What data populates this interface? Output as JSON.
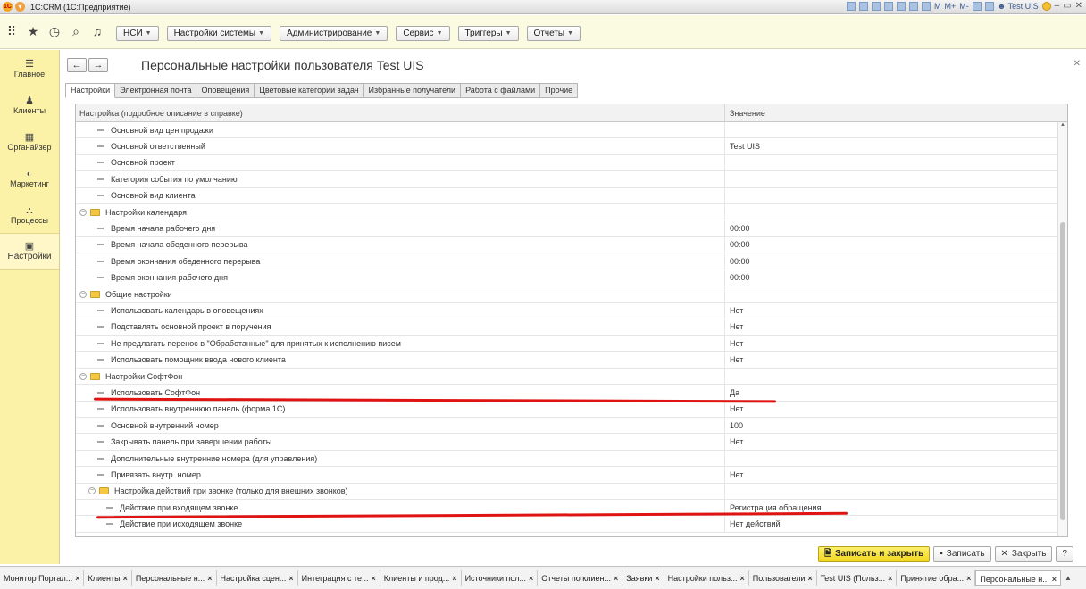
{
  "app": {
    "title": "1С:CRM  (1С:Предприятие)",
    "user": "Test UIS"
  },
  "titlebar_icons": [
    "M",
    "M+",
    "M-"
  ],
  "toolbar": {
    "menus": [
      "НСИ",
      "Настройки системы",
      "Администрирование",
      "Сервис",
      "Триггеры",
      "Отчеты"
    ]
  },
  "sidebar": {
    "items": [
      {
        "label": "Главное",
        "icon": "☰"
      },
      {
        "label": "Клиенты",
        "icon": "👥"
      },
      {
        "label": "Органайзер",
        "icon": "▦"
      },
      {
        "label": "Маркетинг",
        "icon": "◐"
      },
      {
        "label": "Процессы",
        "icon": "⛬"
      },
      {
        "label": "Настройки",
        "icon": "▣"
      }
    ]
  },
  "page": {
    "title": "Персональные настройки пользователя Test UIS",
    "tabs": [
      "Настройки",
      "Электронная почта",
      "Оповещения",
      "Цветовые категории задач",
      "Избранные получатели",
      "Работа с файлами",
      "Прочие"
    ]
  },
  "grid": {
    "col1": "Настройка (подробное описание в справке)",
    "col2": "Значение",
    "rows": [
      {
        "type": "item",
        "label": "Основной вид цен продажи",
        "value": ""
      },
      {
        "type": "item",
        "label": "Основной ответственный",
        "value": "Test UIS"
      },
      {
        "type": "item",
        "label": "Основной проект",
        "value": ""
      },
      {
        "type": "item",
        "label": "Категория события по умолчанию",
        "value": ""
      },
      {
        "type": "item",
        "label": "Основной вид клиента",
        "value": ""
      },
      {
        "type": "group",
        "label": "Настройки календаря",
        "value": ""
      },
      {
        "type": "item",
        "label": "Время начала рабочего дня",
        "value": "00:00"
      },
      {
        "type": "item",
        "label": "Время начала обеденного перерыва",
        "value": "00:00"
      },
      {
        "type": "item",
        "label": "Время окончания обеденного перерыва",
        "value": "00:00"
      },
      {
        "type": "item",
        "label": "Время окончания рабочего дня",
        "value": "00:00"
      },
      {
        "type": "group",
        "label": "Общие настройки",
        "value": ""
      },
      {
        "type": "item",
        "label": "Использовать календарь в оповещениях",
        "value": "Нет"
      },
      {
        "type": "item",
        "label": "Подставлять основной проект в поручения",
        "value": "Нет"
      },
      {
        "type": "item",
        "label": "Не предлагать перенос в \"Обработанные\" для принятых к исполнению писем",
        "value": "Нет"
      },
      {
        "type": "item",
        "label": "Использовать помощник ввода нового клиента",
        "value": "Нет"
      },
      {
        "type": "group",
        "label": "Настройки СофтФон",
        "value": ""
      },
      {
        "type": "item",
        "label": "Использовать СофтФон",
        "value": "Да"
      },
      {
        "type": "item",
        "label": "Использовать внутреннюю панель (форма 1С)",
        "value": "Нет"
      },
      {
        "type": "item",
        "label": "Основной внутренний номер",
        "value": "100"
      },
      {
        "type": "item",
        "label": "Закрывать панель при завершении работы",
        "value": "Нет"
      },
      {
        "type": "item",
        "label": "Дополнительные внутренние номера (для управления)",
        "value": ""
      },
      {
        "type": "item",
        "label": "Привязать внутр. номер",
        "value": "Нет"
      },
      {
        "type": "subgroup",
        "label": "Настройка действий при звонке (только для внешних звонков)",
        "value": ""
      },
      {
        "type": "subitem",
        "label": "Действие при входящем звонке",
        "value": "Регистрация обращения"
      },
      {
        "type": "subitem",
        "label": "Действие при исходящем звонке",
        "value": "Нет действий"
      }
    ]
  },
  "buttons": {
    "save_close": "Записать и закрыть",
    "save": "Записать",
    "close": "Закрыть",
    "help": "?"
  },
  "taskbar": {
    "tabs": [
      "Монитор Портал...",
      "Клиенты",
      "Персональные н...",
      "Настройка сцен...",
      "Интеграция с те...",
      "Клиенты и прод...",
      "Источники пол...",
      "Отчеты по клиен...",
      "Заявки",
      "Настройки польз...",
      "Пользователи",
      "Test UIS (Польз...",
      "Принятие обра...",
      "Персональные н..."
    ]
  }
}
